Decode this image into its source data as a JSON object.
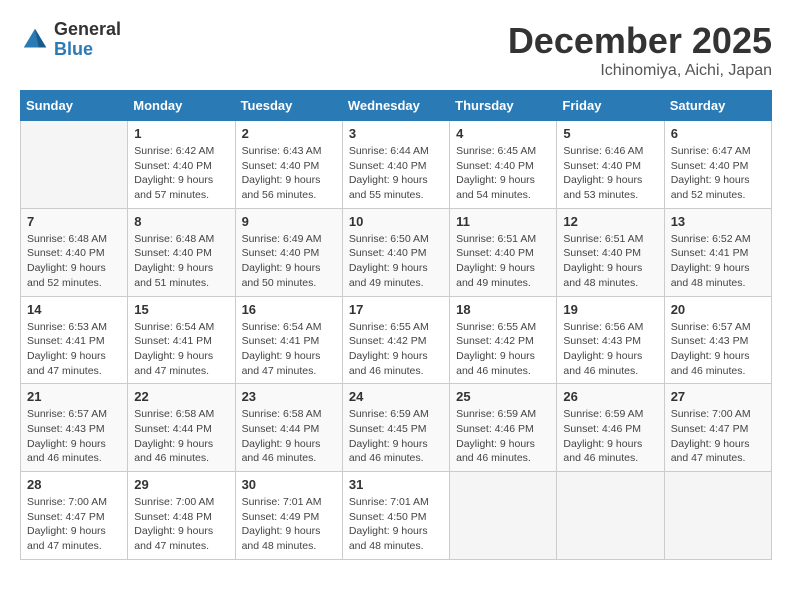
{
  "logo": {
    "general": "General",
    "blue": "Blue"
  },
  "header": {
    "month": "December 2025",
    "location": "Ichinomiya, Aichi, Japan"
  },
  "weekdays": [
    "Sunday",
    "Monday",
    "Tuesday",
    "Wednesday",
    "Thursday",
    "Friday",
    "Saturday"
  ],
  "weeks": [
    [
      {
        "day": "",
        "info": ""
      },
      {
        "day": "1",
        "info": "Sunrise: 6:42 AM\nSunset: 4:40 PM\nDaylight: 9 hours\nand 57 minutes."
      },
      {
        "day": "2",
        "info": "Sunrise: 6:43 AM\nSunset: 4:40 PM\nDaylight: 9 hours\nand 56 minutes."
      },
      {
        "day": "3",
        "info": "Sunrise: 6:44 AM\nSunset: 4:40 PM\nDaylight: 9 hours\nand 55 minutes."
      },
      {
        "day": "4",
        "info": "Sunrise: 6:45 AM\nSunset: 4:40 PM\nDaylight: 9 hours\nand 54 minutes."
      },
      {
        "day": "5",
        "info": "Sunrise: 6:46 AM\nSunset: 4:40 PM\nDaylight: 9 hours\nand 53 minutes."
      },
      {
        "day": "6",
        "info": "Sunrise: 6:47 AM\nSunset: 4:40 PM\nDaylight: 9 hours\nand 52 minutes."
      }
    ],
    [
      {
        "day": "7",
        "info": "Sunrise: 6:48 AM\nSunset: 4:40 PM\nDaylight: 9 hours\nand 52 minutes."
      },
      {
        "day": "8",
        "info": "Sunrise: 6:48 AM\nSunset: 4:40 PM\nDaylight: 9 hours\nand 51 minutes."
      },
      {
        "day": "9",
        "info": "Sunrise: 6:49 AM\nSunset: 4:40 PM\nDaylight: 9 hours\nand 50 minutes."
      },
      {
        "day": "10",
        "info": "Sunrise: 6:50 AM\nSunset: 4:40 PM\nDaylight: 9 hours\nand 49 minutes."
      },
      {
        "day": "11",
        "info": "Sunrise: 6:51 AM\nSunset: 4:40 PM\nDaylight: 9 hours\nand 49 minutes."
      },
      {
        "day": "12",
        "info": "Sunrise: 6:51 AM\nSunset: 4:40 PM\nDaylight: 9 hours\nand 48 minutes."
      },
      {
        "day": "13",
        "info": "Sunrise: 6:52 AM\nSunset: 4:41 PM\nDaylight: 9 hours\nand 48 minutes."
      }
    ],
    [
      {
        "day": "14",
        "info": "Sunrise: 6:53 AM\nSunset: 4:41 PM\nDaylight: 9 hours\nand 47 minutes."
      },
      {
        "day": "15",
        "info": "Sunrise: 6:54 AM\nSunset: 4:41 PM\nDaylight: 9 hours\nand 47 minutes."
      },
      {
        "day": "16",
        "info": "Sunrise: 6:54 AM\nSunset: 4:41 PM\nDaylight: 9 hours\nand 47 minutes."
      },
      {
        "day": "17",
        "info": "Sunrise: 6:55 AM\nSunset: 4:42 PM\nDaylight: 9 hours\nand 46 minutes."
      },
      {
        "day": "18",
        "info": "Sunrise: 6:55 AM\nSunset: 4:42 PM\nDaylight: 9 hours\nand 46 minutes."
      },
      {
        "day": "19",
        "info": "Sunrise: 6:56 AM\nSunset: 4:43 PM\nDaylight: 9 hours\nand 46 minutes."
      },
      {
        "day": "20",
        "info": "Sunrise: 6:57 AM\nSunset: 4:43 PM\nDaylight: 9 hours\nand 46 minutes."
      }
    ],
    [
      {
        "day": "21",
        "info": "Sunrise: 6:57 AM\nSunset: 4:43 PM\nDaylight: 9 hours\nand 46 minutes."
      },
      {
        "day": "22",
        "info": "Sunrise: 6:58 AM\nSunset: 4:44 PM\nDaylight: 9 hours\nand 46 minutes."
      },
      {
        "day": "23",
        "info": "Sunrise: 6:58 AM\nSunset: 4:44 PM\nDaylight: 9 hours\nand 46 minutes."
      },
      {
        "day": "24",
        "info": "Sunrise: 6:59 AM\nSunset: 4:45 PM\nDaylight: 9 hours\nand 46 minutes."
      },
      {
        "day": "25",
        "info": "Sunrise: 6:59 AM\nSunset: 4:46 PM\nDaylight: 9 hours\nand 46 minutes."
      },
      {
        "day": "26",
        "info": "Sunrise: 6:59 AM\nSunset: 4:46 PM\nDaylight: 9 hours\nand 46 minutes."
      },
      {
        "day": "27",
        "info": "Sunrise: 7:00 AM\nSunset: 4:47 PM\nDaylight: 9 hours\nand 47 minutes."
      }
    ],
    [
      {
        "day": "28",
        "info": "Sunrise: 7:00 AM\nSunset: 4:47 PM\nDaylight: 9 hours\nand 47 minutes."
      },
      {
        "day": "29",
        "info": "Sunrise: 7:00 AM\nSunset: 4:48 PM\nDaylight: 9 hours\nand 47 minutes."
      },
      {
        "day": "30",
        "info": "Sunrise: 7:01 AM\nSunset: 4:49 PM\nDaylight: 9 hours\nand 48 minutes."
      },
      {
        "day": "31",
        "info": "Sunrise: 7:01 AM\nSunset: 4:50 PM\nDaylight: 9 hours\nand 48 minutes."
      },
      {
        "day": "",
        "info": ""
      },
      {
        "day": "",
        "info": ""
      },
      {
        "day": "",
        "info": ""
      }
    ]
  ]
}
